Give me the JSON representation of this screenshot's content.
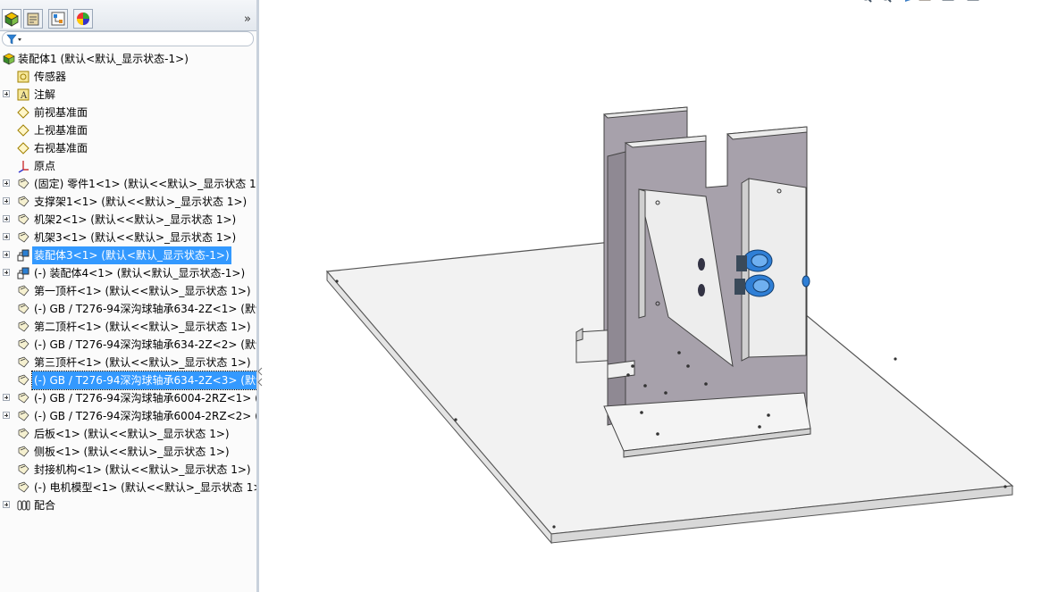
{
  "feature_tree": {
    "expand_label": "»",
    "tabs": [
      "feature-manager-icon",
      "property-manager-icon",
      "configuration-manager-icon",
      "display-manager-icon"
    ],
    "items": [
      {
        "label": "装配体1  (默认<默认_显示状态-1>)",
        "icon": "assembly-icon",
        "expandable": false
      },
      {
        "label": "传感器",
        "icon": "sensor-icon",
        "expandable": false
      },
      {
        "label": "注解",
        "icon": "annotation-icon",
        "expandable": true
      },
      {
        "label": "前视基准面",
        "icon": "plane-icon",
        "expandable": false
      },
      {
        "label": "上视基准面",
        "icon": "plane-icon",
        "expandable": false
      },
      {
        "label": "右视基准面",
        "icon": "plane-icon",
        "expandable": false
      },
      {
        "label": "原点",
        "icon": "origin-icon",
        "expandable": false
      },
      {
        "label": "(固定) 零件1<1> (默认<<默认>_显示状态 1>",
        "icon": "part-icon",
        "expandable": true
      },
      {
        "label": "支撑架1<1> (默认<<默认>_显示状态 1>)",
        "icon": "part-icon",
        "expandable": true
      },
      {
        "label": "机架2<1> (默认<<默认>_显示状态 1>)",
        "icon": "part-icon",
        "expandable": true
      },
      {
        "label": "机架3<1> (默认<<默认>_显示状态 1>)",
        "icon": "part-icon",
        "expandable": true
      },
      {
        "label": "装配体3<1> (默认<默认_显示状态-1>)",
        "icon": "subassembly-icon",
        "expandable": true
      },
      {
        "label": "(-) 装配体4<1> (默认<默认_显示状态-1>)",
        "icon": "subassembly-icon",
        "expandable": true
      },
      {
        "label": "第一顶杆<1> (默认<<默认>_显示状态 1>)",
        "icon": "part-icon",
        "expandable": false
      },
      {
        "label": "(-) GB / T276-94深沟球轴承634-2Z<1> (默认",
        "icon": "part-icon",
        "expandable": false
      },
      {
        "label": "第二顶杆<1> (默认<<默认>_显示状态 1>)",
        "icon": "part-icon",
        "expandable": false
      },
      {
        "label": "(-) GB / T276-94深沟球轴承634-2Z<2> (默认",
        "icon": "part-icon",
        "expandable": false
      },
      {
        "label": "第三顶杆<1> (默认<<默认>_显示状态 1>)",
        "icon": "part-icon",
        "expandable": false
      },
      {
        "label": "(-) GB / T276-94深沟球轴承634-2Z<3> (默认",
        "icon": "part-icon",
        "expandable": false
      },
      {
        "label": "(-) GB / T276-94深沟球轴承6004-2RZ<1> (默",
        "icon": "part-icon",
        "expandable": true
      },
      {
        "label": "(-) GB / T276-94深沟球轴承6004-2RZ<2> (默",
        "icon": "part-icon",
        "expandable": true
      },
      {
        "label": "后板<1> (默认<<默认>_显示状态 1>)",
        "icon": "part-icon",
        "expandable": false
      },
      {
        "label": "侧板<1> (默认<<默认>_显示状态 1>)",
        "icon": "part-icon",
        "expandable": false
      },
      {
        "label": "封接机构<1> (默认<<默认>_显示状态 1>)",
        "icon": "part-icon",
        "expandable": false
      },
      {
        "label": "(-) 电机模型<1> (默认<<默认>_显示状态 1>)",
        "icon": "part-icon",
        "expandable": false
      },
      {
        "label": "配合",
        "icon": "mates-icon",
        "expandable": true
      }
    ]
  },
  "colors": {
    "selection": "#3399ff",
    "plate_top": "#f2f2f2",
    "frame_face": "#a7a1ab",
    "bearing": "#2f7fd6"
  }
}
